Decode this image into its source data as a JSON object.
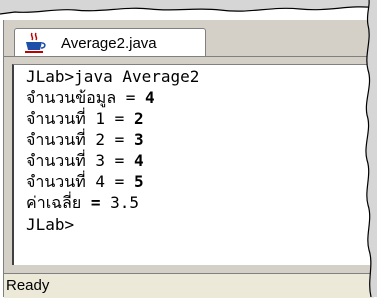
{
  "tab": {
    "title": "Average2.java",
    "icon": "java-cup-icon"
  },
  "console": {
    "command": {
      "prompt": "JLab>",
      "text": "java Average2"
    },
    "lines": [
      {
        "label": "จำนวนข้อมูล",
        "op": " = ",
        "value": "4"
      },
      {
        "label": "จำนวนที่",
        "index": " 1",
        "op": " = ",
        "value": "2"
      },
      {
        "label": "จำนวนที่",
        "index": " 2",
        "op": " = ",
        "value": "3"
      },
      {
        "label": "จำนวนที่",
        "index": " 3",
        "op": " = ",
        "value": "4"
      },
      {
        "label": "จำนวนที่",
        "index": " 4",
        "op": " = ",
        "value": "5"
      }
    ],
    "average": {
      "label": "ค่าเฉลี่ย",
      "op": " = ",
      "value": "3.5"
    },
    "prompt_end": "JLab>"
  },
  "status": {
    "text": "Ready"
  }
}
